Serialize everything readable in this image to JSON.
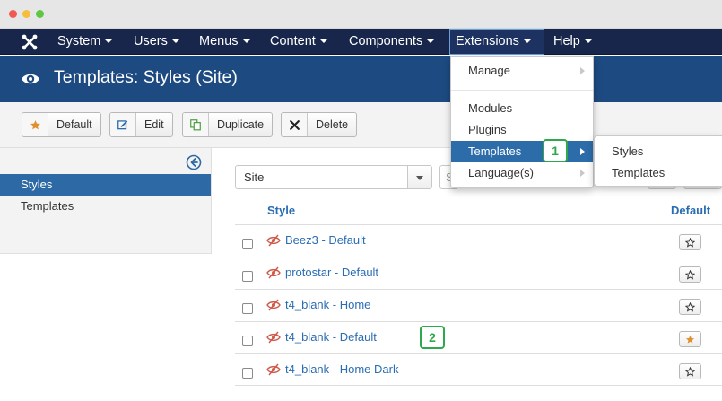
{
  "nav": {
    "items": [
      {
        "label": "System"
      },
      {
        "label": "Users"
      },
      {
        "label": "Menus"
      },
      {
        "label": "Content"
      },
      {
        "label": "Components"
      },
      {
        "label": "Extensions"
      },
      {
        "label": "Help"
      }
    ],
    "active": "Extensions"
  },
  "page": {
    "title": "Templates: Styles (Site)"
  },
  "toolbar": {
    "default_label": "Default",
    "edit_label": "Edit",
    "duplicate_label": "Duplicate",
    "delete_label": "Delete"
  },
  "sidebar": {
    "items": [
      {
        "label": "Styles",
        "active": true
      },
      {
        "label": "Templates",
        "active": false
      }
    ]
  },
  "filter": {
    "client_value": "Site",
    "search_partial": "S"
  },
  "table": {
    "columns": [
      "Style",
      "Default"
    ],
    "rows": [
      {
        "name": "Beez3 - Default",
        "is_default": false
      },
      {
        "name": "protostar - Default",
        "is_default": false
      },
      {
        "name": "t4_blank - Home",
        "is_default": false
      },
      {
        "name": "t4_blank - Default",
        "is_default": true
      },
      {
        "name": "t4_blank - Home Dark",
        "is_default": false
      }
    ]
  },
  "extensions_menu": {
    "items": [
      {
        "label": "Manage",
        "has_submenu": true
      },
      {
        "label": "Modules",
        "has_submenu": false
      },
      {
        "label": "Plugins",
        "has_submenu": false
      },
      {
        "label": "Templates",
        "has_submenu": true,
        "active": true
      },
      {
        "label": "Language(s)",
        "has_submenu": true
      }
    ]
  },
  "templates_submenu": {
    "items": [
      {
        "label": "Styles"
      },
      {
        "label": "Templates"
      }
    ]
  },
  "callouts": [
    "1",
    "2"
  ],
  "colors": {
    "navbar": "#17264a",
    "titlebar": "#1d4a80",
    "accent": "#2c69a5",
    "link": "#2a6db3",
    "callout": "#2ea84d",
    "default_star": "#e0912f"
  }
}
